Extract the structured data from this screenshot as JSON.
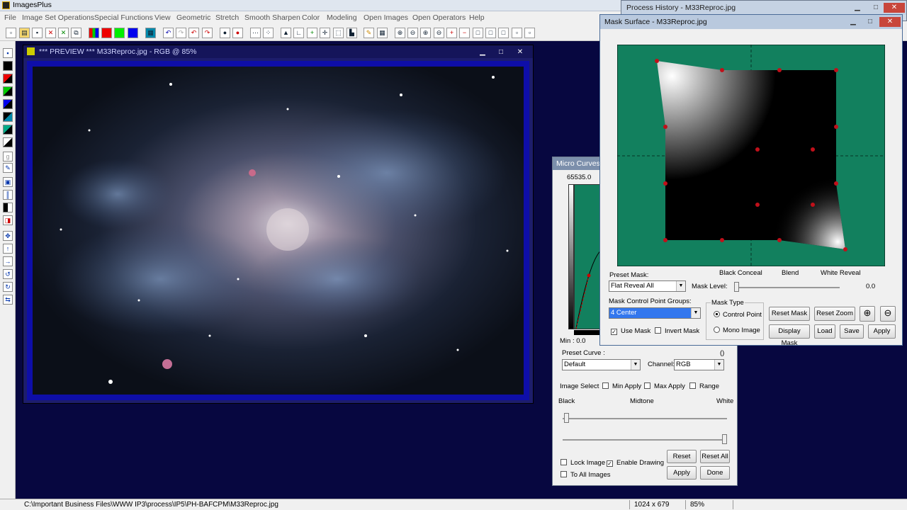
{
  "app": {
    "title": "ImagesPlus"
  },
  "menu": [
    "File",
    "Image Set Operations",
    "Special Functions",
    "View",
    "Geometric",
    "Stretch",
    "Smooth Sharpen",
    "Color",
    "Modeling",
    "Open Images",
    "Open Operators",
    "Help"
  ],
  "preview": {
    "title": "*** PREVIEW *** M33Reproc.jpg - RGB @ 85%"
  },
  "micro_curves": {
    "title": "Micro Curves",
    "max_label": "65535.0",
    "min_label": "Min : 0.0",
    "preset_curve_label": "Preset Curve :",
    "preset_curve_bracket": "()",
    "preset_curve_value": "Default",
    "channel_label": "Channel:",
    "channel_value": "RGB",
    "image_select_label": "Image Select",
    "min_apply": "Min Apply",
    "max_apply": "Max Apply",
    "range": "Range",
    "black": "Black",
    "midtone": "Midtone",
    "white": "White",
    "lock_image": "Lock Image",
    "enable_drawing": "Enable Drawing",
    "to_all_images": "To All Images",
    "reset": "Reset",
    "reset_all": "Reset All",
    "apply": "Apply",
    "done": "Done"
  },
  "process_history": {
    "title": "Process History - M33Reproc.jpg"
  },
  "mask_surface": {
    "title": "Mask Surface - M33Reproc.jpg",
    "preset_mask_label": "Preset Mask:",
    "preset_mask_value": "Flat Reveal All",
    "black_conceal": "Black Conceal",
    "blend": "Blend",
    "white_reveal": "White Reveal",
    "mask_level_label": "Mask Level:",
    "mask_level_value": "0.0",
    "mask_level": 0,
    "groups_label": "Mask Control Point Groups:",
    "groups_value": "4 Center",
    "mask_type_label": "Mask Type",
    "control_point": "Control Point",
    "mono_image": "Mono Image",
    "use_mask": "Use Mask",
    "invert_mask": "Invert Mask",
    "reset_mask": "Reset Mask",
    "reset_zoom": "Reset Zoom",
    "display_mask": "Display Mask",
    "load": "Load",
    "save": "Save",
    "apply": "Apply"
  },
  "status": {
    "path": "C:\\Important Business Files\\WWW IP3\\process\\IP5\\PH-BAFCPM\\M33Reproc.jpg",
    "dims": "1024 x 679",
    "zoom": "85%"
  },
  "colors": {
    "workspace": "#070740",
    "mask_bg": "#12805e",
    "title_active": "#5a7fb8",
    "control_point": "#c0101a"
  },
  "icons": [
    "new-icon",
    "open-icon",
    "save-icon",
    "close-icon",
    "undo-icon",
    "redo-icon",
    "zoom-in-icon",
    "zoom-out-icon"
  ]
}
